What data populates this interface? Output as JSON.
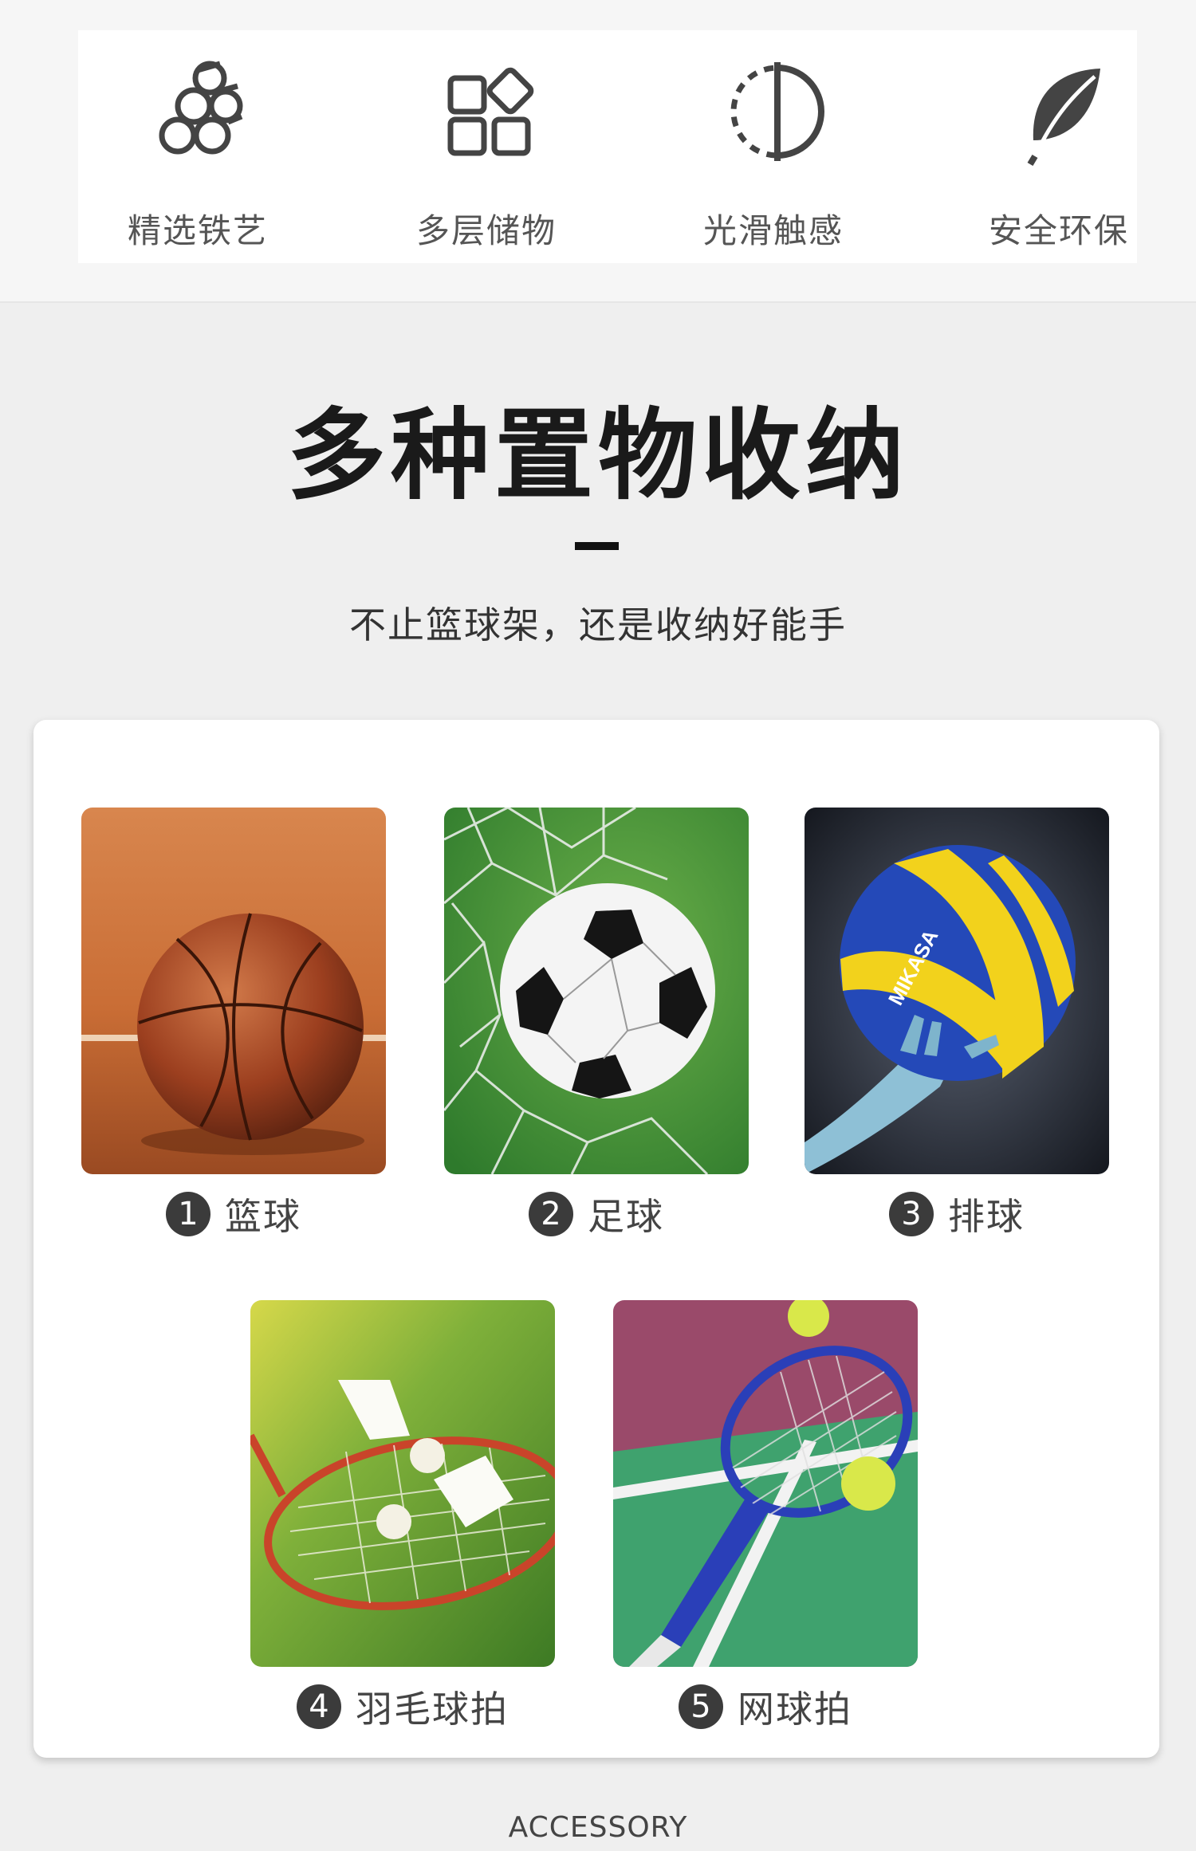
{
  "features": [
    {
      "label": "精选铁艺",
      "icon": "iron-pipes-icon"
    },
    {
      "label": "多层储物",
      "icon": "grid-layers-icon"
    },
    {
      "label": "光滑触感",
      "icon": "smooth-touch-icon"
    },
    {
      "label": "安全环保",
      "icon": "leaf-icon"
    }
  ],
  "heading": {
    "title": "多种置物收纳",
    "subtitle": "不止篮球架，还是收纳好能手"
  },
  "sports": [
    {
      "num": "1",
      "label": "篮球"
    },
    {
      "num": "2",
      "label": "足球"
    },
    {
      "num": "3",
      "label": "排球"
    },
    {
      "num": "4",
      "label": "羽毛球拍"
    },
    {
      "num": "5",
      "label": "网球拍"
    }
  ],
  "volleyball_brand": "MIKASA",
  "footer": "ACCESSORY"
}
